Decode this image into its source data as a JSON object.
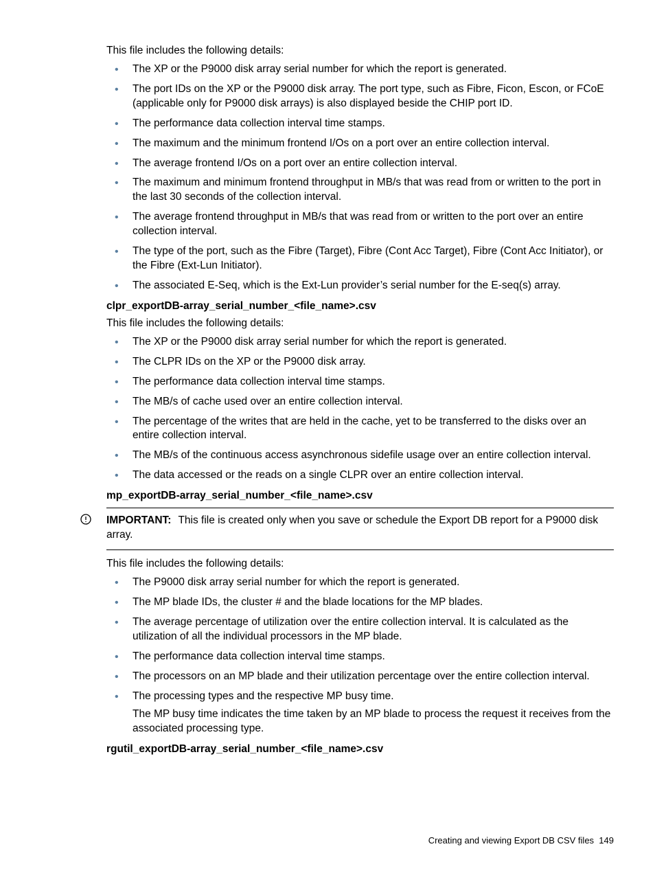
{
  "section1": {
    "intro": "This file includes the following details:",
    "items": [
      "The XP or the P9000 disk array serial number for which the report is generated.",
      "The port IDs on the XP or the P9000 disk array. The port type, such as Fibre, Ficon, Escon, or FCoE (applicable only for P9000 disk arrays) is also displayed beside the CHIP port ID.",
      "The performance data collection interval time stamps.",
      "The maximum and the minimum frontend I/Os on a port over an entire collection interval.",
      "The average frontend I/Os on a port over an entire collection interval.",
      "The maximum and minimum frontend throughput in MB/s that was read from or written to the port in the last 30 seconds of the collection interval.",
      "The average frontend throughput in MB/s that was read from or written to the port over an entire collection interval.",
      "The type of the port, such as the Fibre (Target), Fibre (Cont Acc Target), Fibre (Cont Acc Initiator), or the Fibre (Ext-Lun Initiator).",
      "The associated E-Seq, which is the Ext-Lun provider’s serial number for the E-seq(s) array."
    ]
  },
  "section2": {
    "heading": "clpr_exportDB-array_serial_number_<file_name>.csv",
    "intro": "This file includes the following details:",
    "items": [
      "The XP or the P9000 disk array serial number for which the report is generated.",
      "The CLPR IDs on the XP or the P9000 disk array.",
      "The performance data collection interval time stamps.",
      "The MB/s of cache used over an entire collection interval.",
      "The percentage of the writes that are held in the cache, yet to be transferred to the disks over an entire collection interval.",
      "The MB/s of the continuous access asynchronous sidefile usage over an entire collection interval.",
      "The data accessed or the reads on a single CLPR over an entire collection interval."
    ]
  },
  "section3": {
    "heading": "mp_exportDB-array_serial_number_<file_name>.csv",
    "note_label": "IMPORTANT:",
    "note_text": "This file is created only when you save or schedule the Export DB report for a P9000 disk array.",
    "intro": "This file includes the following details:",
    "items": [
      {
        "text": "The P9000 disk array serial number for which the report is generated."
      },
      {
        "text": "The MP blade IDs, the cluster # and the blade locations for the MP blades."
      },
      {
        "text": "The average percentage of utilization over the entire collection interval. It is calculated as the utilization of all the individual processors in the MP blade."
      },
      {
        "text": "The performance data collection interval time stamps."
      },
      {
        "text": "The processors on an MP blade and their utilization percentage over the entire collection interval."
      },
      {
        "text": "The processing types and the respective MP busy time.",
        "cont": "The MP busy time indicates the time taken by an MP blade to process the request it receives from the associated processing type."
      }
    ]
  },
  "section4": {
    "heading": "rgutil_exportDB-array_serial_number_<file_name>.csv"
  },
  "footer": {
    "text": "Creating and viewing Export DB CSV files",
    "page": "149"
  }
}
